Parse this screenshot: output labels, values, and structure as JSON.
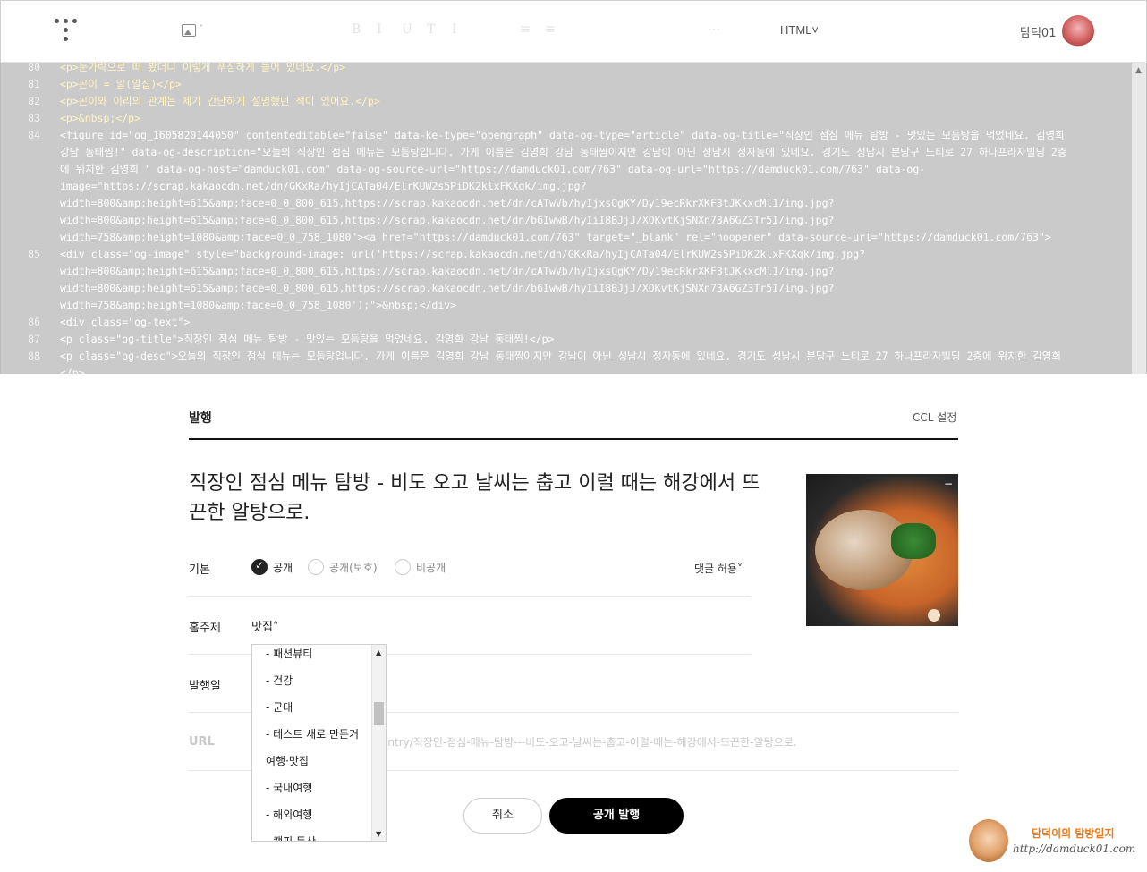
{
  "toolbar": {
    "html_mode": "HTML˅",
    "faint_tools": [
      "B",
      "I",
      "U",
      "T",
      "I",
      "≡",
      "≡",
      "⋯"
    ],
    "username": "담덕01",
    "image_caret": "˅"
  },
  "code": {
    "lines": [
      {
        "n": "80",
        "t": "<p>눈가락으로 떠 봤더니 이렇게 푸짐하게 들어 있네요.</p>"
      },
      {
        "n": "81",
        "t": "<p>곤이 = 알(알집)</p>"
      },
      {
        "n": "82",
        "t": "<p>곤이와 이리의 관계는 제가 간단하게 설명했던 적이 있어요.</p>"
      },
      {
        "n": "83",
        "t": "<p>&nbsp;</p>"
      },
      {
        "n": "84",
        "t": "<figure id=\"og_1605820144050\" contenteditable=\"false\" data-ke-type=\"opengraph\" data-og-type=\"article\" data-og-title=\"직장인 점심 메뉴 탐방 - 맛있는 모듬탕을 먹었네요. 김영희 강남 동태찜!\" data-og-description=\"오늘의 직장인 점심 메뉴는 모듬탕입니다. 가게 이름은 김영희 강남 동태찜이지만 강남이 아닌 성남시 정자동에 있네요. 경기도 성남시 분당구 느티로 27 하나프라자빌딩 2층에 위치한 김영희 \" data-og-host=\"damduck01.com\" data-og-source-url=\"https://damduck01.com/763\" data-og-url=\"https://damduck01.com/763\" data-og-image=\"https://scrap.kakaocdn.net/dn/GKxRa/hyIjCATa04/ElrKUW2s5PiDK2klxFKXqk/img.jpg?width=800&amp;height=615&amp;face=0_0_800_615,https://scrap.kakaocdn.net/dn/cATwVb/hyIjxsOgKY/Dy19ecRkrXKF3tJKkxcMl1/img.jpg?width=800&amp;height=615&amp;face=0_0_800_615,https://scrap.kakaocdn.net/dn/b6IwwB/hyIiI8BJjJ/XQKvtKjSNXn73A6GZ3Tr5I/img.jpg?width=758&amp;height=1080&amp;face=0_0_758_1080\"><a href=\"https://damduck01.com/763\" target=\"_blank\" rel=\"noopener\" data-source-url=\"https://damduck01.com/763\">"
      },
      {
        "n": "85",
        "t": "<div class=\"og-image\" style=\"background-image: url('https://scrap.kakaocdn.net/dn/GKxRa/hyIjCATa04/ElrKUW2s5PiDK2klxFKXqk/img.jpg?width=800&amp;height=615&amp;face=0_0_800_615,https://scrap.kakaocdn.net/dn/cATwVb/hyIjxsOgKY/Dy19ecRkrXKF3tJKkxcMl1/img.jpg?width=800&amp;height=615&amp;face=0_0_800_615,https://scrap.kakaocdn.net/dn/b6IwwB/hyIiI8BJjJ/XQKvtKjSNXn73A6GZ3Tr5I/img.jpg?width=758&amp;height=1080&amp;face=0_0_758_1080');\">&nbsp;</div>"
      },
      {
        "n": "86",
        "t": "<div class=\"og-text\">"
      },
      {
        "n": "87",
        "t": "<p class=\"og-title\">직장인 점심 메뉴 탐방 - 맛있는 모듬탕을 먹었네요. 김영희 강남 동태찜!</p>"
      },
      {
        "n": "88",
        "t": "<p class=\"og-desc\">오늘의 직장인 점심 메뉴는 모듬탕입니다. 가게 이름은 김영희 강남 동태찜이지만 강남이 아닌 성남시 정자동에 있네요. 경기도 성남시 분당구 느티로 27 하나프라자빌딩 2층에 위치한 김영희</p>"
      }
    ]
  },
  "publish": {
    "heading": "발행",
    "ccl": "CCL 설정",
    "post_title": "직장인 점심 메뉴 탐방 - 비도 오고 날씨는 춥고 이럴 때는 해강에서 뜨끈한 알탕으로.",
    "basic_label": "기본",
    "visibility": {
      "public": "공개",
      "protected": "공개(보호)",
      "private": "비공개"
    },
    "comment": "댓글 허용˅",
    "topic_label": "홈주제",
    "topic_value": "맛집˄",
    "date_label": "발행일",
    "url_label": "URL",
    "url_value": "entry/직장인-점심-메뉴-탐방---비도-오고-날씨는-춥고-이럴-때는-해강에서-뜨끈한-알탕으로.",
    "cancel": "취소",
    "submit": "공개 발행"
  },
  "dropdown": {
    "items": [
      "- 패션뷰티",
      "- 건강",
      "- 군대",
      "- 테스트 새로 만든거",
      "여행·맛집",
      "- 국내여행",
      "- 해외여행",
      "- 캠핑·등산"
    ]
  },
  "watermark": {
    "script": "담덕이의 탐방일지",
    "url": "http://damduck01.com"
  }
}
